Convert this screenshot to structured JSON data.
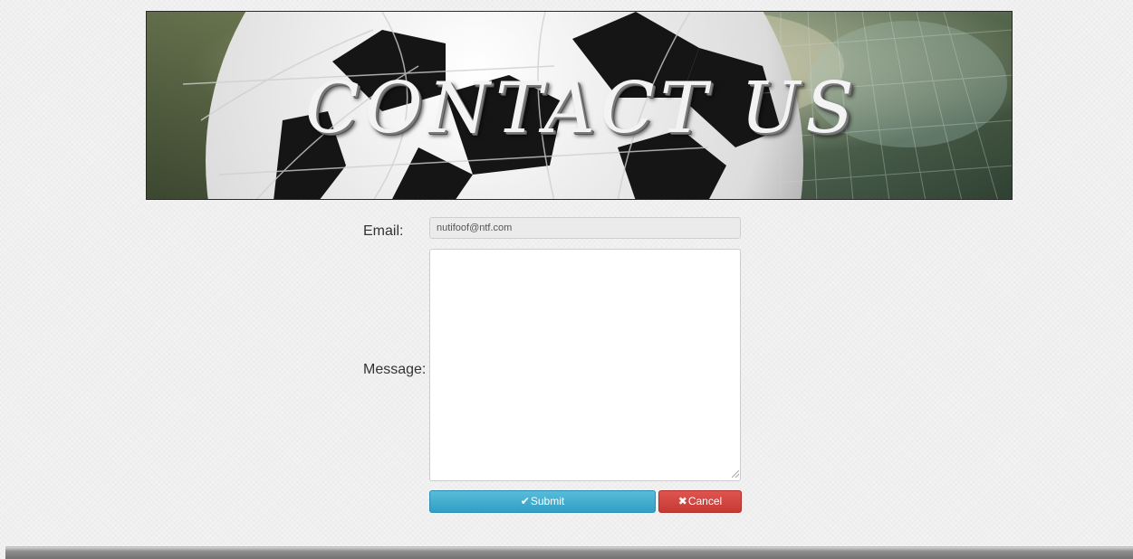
{
  "banner": {
    "title": "CONTACT US"
  },
  "form": {
    "email_label": "Email:",
    "email_value": "nutifoof@ntf.com",
    "message_label": "Message:",
    "message_value": ""
  },
  "actions": {
    "submit_label": "Submit",
    "submit_icon": "✔",
    "cancel_label": "Cancel",
    "cancel_icon": "✖"
  },
  "colors": {
    "submit": "#3ba8cd",
    "cancel": "#d2443f"
  }
}
